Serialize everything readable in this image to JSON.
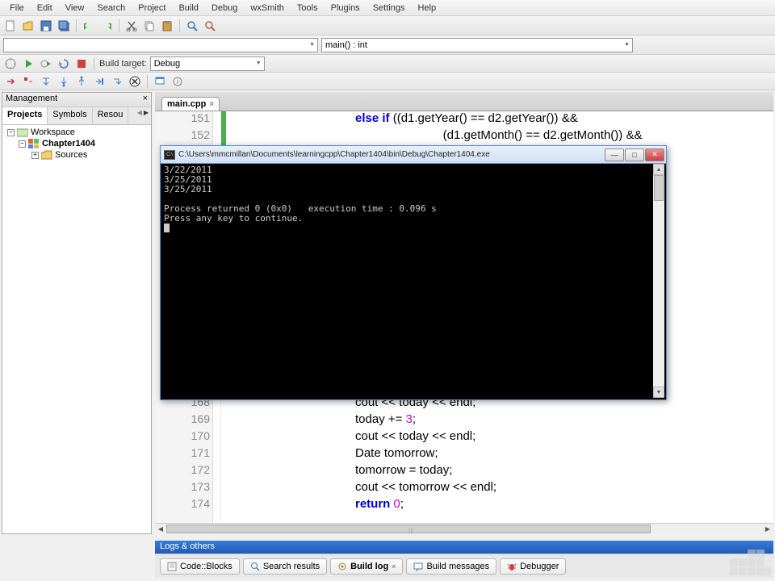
{
  "menu": [
    "File",
    "Edit",
    "View",
    "Search",
    "Project",
    "Build",
    "Debug",
    "wxSmith",
    "Tools",
    "Plugins",
    "Settings",
    "Help"
  ],
  "toolbar2": {
    "scope_combo": "",
    "func_combo": "main() : int"
  },
  "toolbar3": {
    "build_target_label": "Build target:",
    "build_target_value": "Debug"
  },
  "management": {
    "title": "Management",
    "tabs": [
      "Projects",
      "Symbols",
      "Resou"
    ],
    "tree": {
      "root": "Workspace",
      "project": "Chapter1404",
      "folder": "Sources"
    }
  },
  "editor": {
    "tab": "main.cpp",
    "lines": [
      {
        "n": 151,
        "parts": [
          {
            "t": "kw",
            "v": "else if"
          },
          {
            "t": "",
            "v": " ((d1.getYear() == d2.getYear()) &&"
          }
        ]
      },
      {
        "n": 152,
        "parts": [
          {
            "t": "",
            "v": "    (d1.getMonth() == d2.getMonth()) &&"
          }
        ]
      },
      {
        "n": 168,
        "parts": [
          {
            "t": "",
            "v": "cout << today << endl;"
          }
        ]
      },
      {
        "n": 169,
        "parts": [
          {
            "t": "",
            "v": "today += "
          },
          {
            "t": "num",
            "v": "3"
          },
          {
            "t": "",
            "v": ";"
          }
        ]
      },
      {
        "n": 170,
        "parts": [
          {
            "t": "",
            "v": "cout << today << endl;"
          }
        ]
      },
      {
        "n": 171,
        "parts": [
          {
            "t": "",
            "v": "Date tomorrow;"
          }
        ]
      },
      {
        "n": 172,
        "parts": [
          {
            "t": "",
            "v": "tomorrow = today;"
          }
        ]
      },
      {
        "n": 173,
        "parts": [
          {
            "t": "",
            "v": "cout << tomorrow << endl;"
          }
        ]
      },
      {
        "n": 174,
        "parts": [
          {
            "t": "kw",
            "v": "return"
          },
          {
            "t": "",
            "v": " "
          },
          {
            "t": "num",
            "v": "0"
          },
          {
            "t": "",
            "v": ";"
          }
        ]
      }
    ]
  },
  "console": {
    "title": "C:\\Users\\mmcmillan\\Documents\\learningcpp\\Chapter1404\\bin\\Debug\\Chapter1404.exe",
    "lines": [
      "3/22/2011",
      "3/25/2011",
      "3/25/2011",
      "",
      "Process returned 0 (0x0)   execution time : 0.096 s",
      "Press any key to continue."
    ]
  },
  "logs": {
    "header": "Logs & others",
    "tabs": [
      "Code::Blocks",
      "Search results",
      "Build log",
      "Build messages",
      "Debugger"
    ],
    "active": 2
  }
}
